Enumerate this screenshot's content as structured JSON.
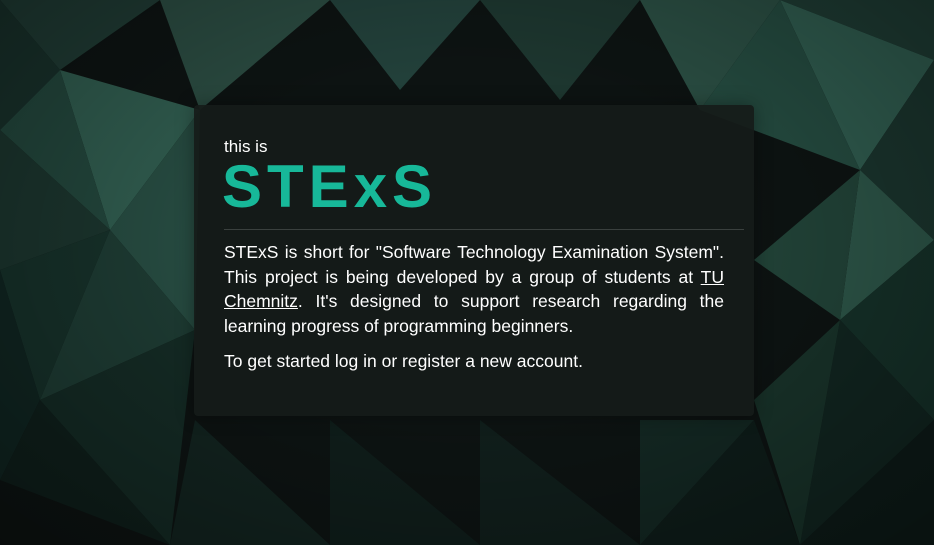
{
  "hero": {
    "intro": "this is",
    "brand": "STExS",
    "description_before_link": "STExS is short for \"Software Technology Examination System\". This project is being developed by a group of students at ",
    "link_label": "TU Chemnitz",
    "description_after_link": ". It's designed to support research regarding the learning progress of programming beginners.",
    "call_to_action": "To get started log in or register a new account."
  },
  "colors": {
    "brand": "#17b899",
    "card_background": "#161b19",
    "text": "#ffffff",
    "background": "#0b0f0e"
  }
}
